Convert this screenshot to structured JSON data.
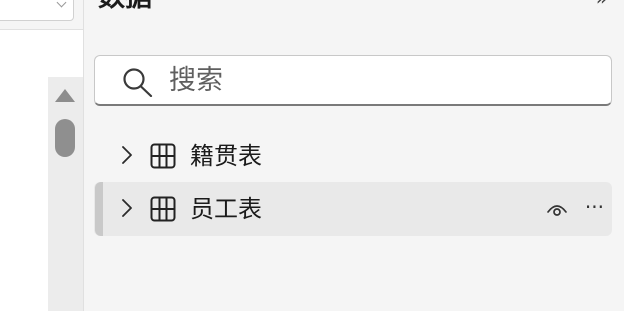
{
  "pane": {
    "title": "数据",
    "collapse_icon": "double-chevron-icon"
  },
  "search": {
    "placeholder": "搜索",
    "value": "",
    "icon": "search-icon"
  },
  "tables": [
    {
      "label": "籍贯表",
      "icon": "table-icon",
      "expanded": false,
      "selected": false
    },
    {
      "label": "员工表",
      "icon": "table-icon",
      "expanded": false,
      "selected": true
    }
  ],
  "row_actions": {
    "visibility_icon": "eye-icon",
    "more_label": "···"
  },
  "colors": {
    "pane_background": "#f5f5f5",
    "selected_row": "#e9e9e9",
    "scrollbar_thumb": "#8f8f8f"
  }
}
